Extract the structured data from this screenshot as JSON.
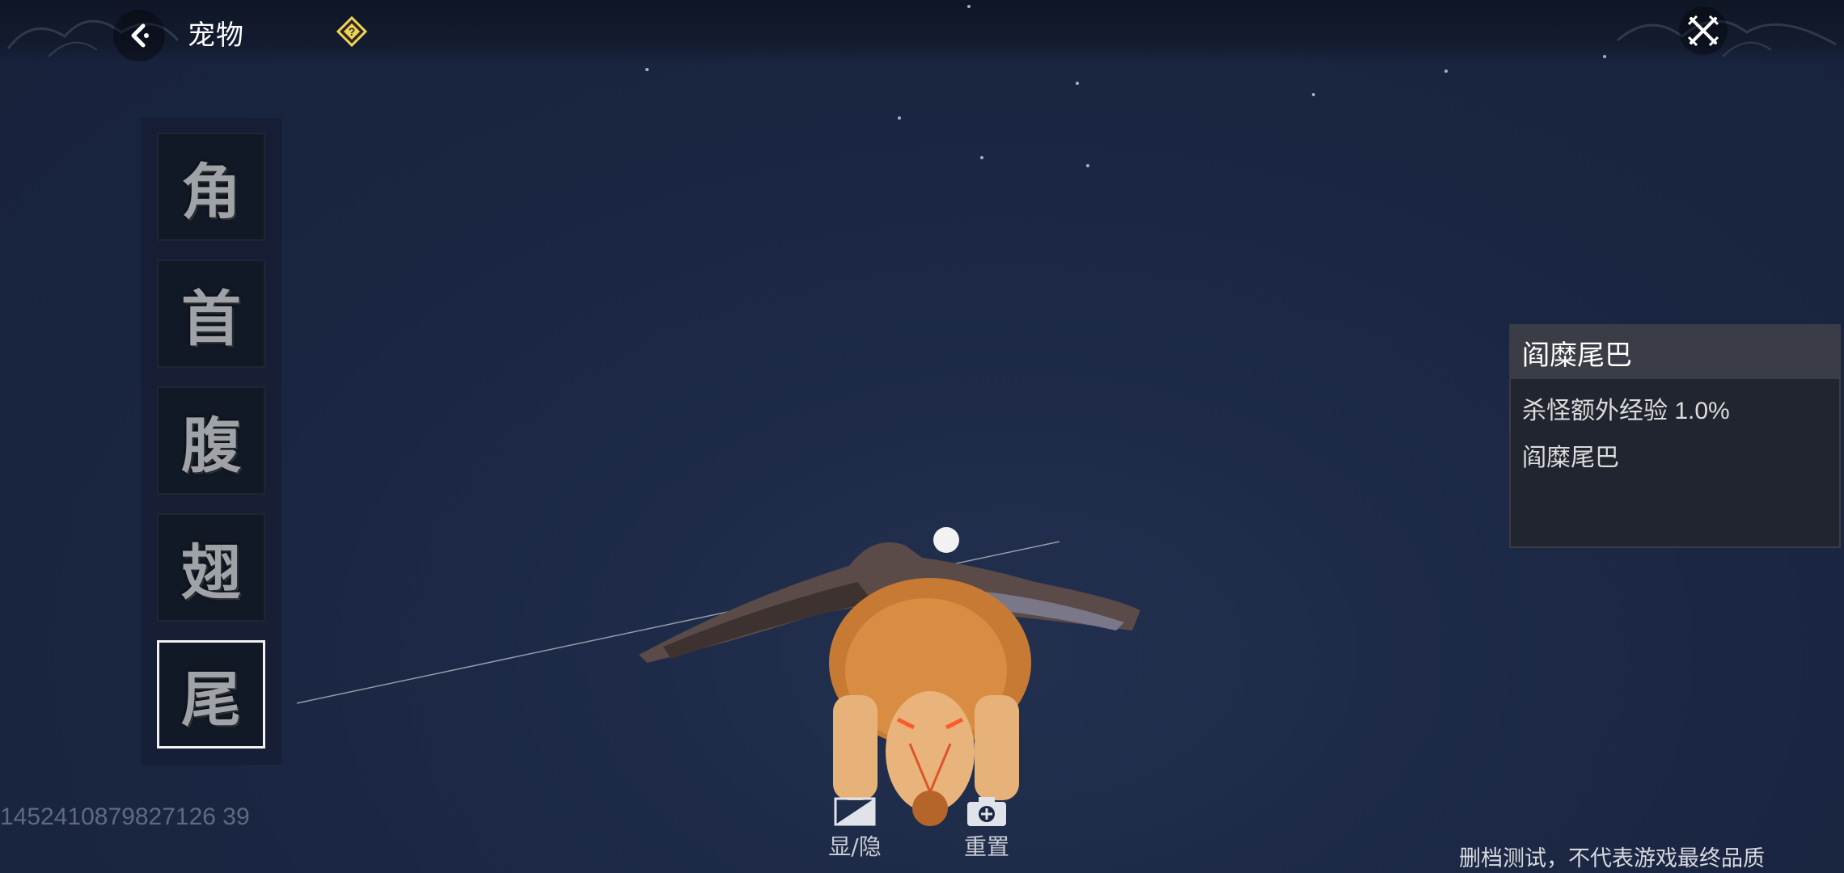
{
  "header": {
    "title": "宠物",
    "back_icon": "back-arrow-icon",
    "help_icon": "help-diamond-icon",
    "close_icon": "close-crossed-swords-icon"
  },
  "parts": [
    {
      "label": "角",
      "selected": false
    },
    {
      "label": "首",
      "selected": false
    },
    {
      "label": "腹",
      "selected": false
    },
    {
      "label": "翅",
      "selected": false
    },
    {
      "label": "尾",
      "selected": true
    }
  ],
  "info": {
    "title": "阎糜尾巴",
    "lines": [
      "杀怪额外经验 1.0%",
      "阎糜尾巴"
    ]
  },
  "tools": {
    "toggle_label": "显/隐",
    "reset_label": "重置"
  },
  "footer": {
    "uid": "1452410879827126 39",
    "disclaimer": "删档测试，不代表游戏最终品质"
  },
  "colors": {
    "background": "#1b2743",
    "panel": "#22252e",
    "panel_header": "#3a3d45",
    "help_accent": "#f2d35a"
  }
}
